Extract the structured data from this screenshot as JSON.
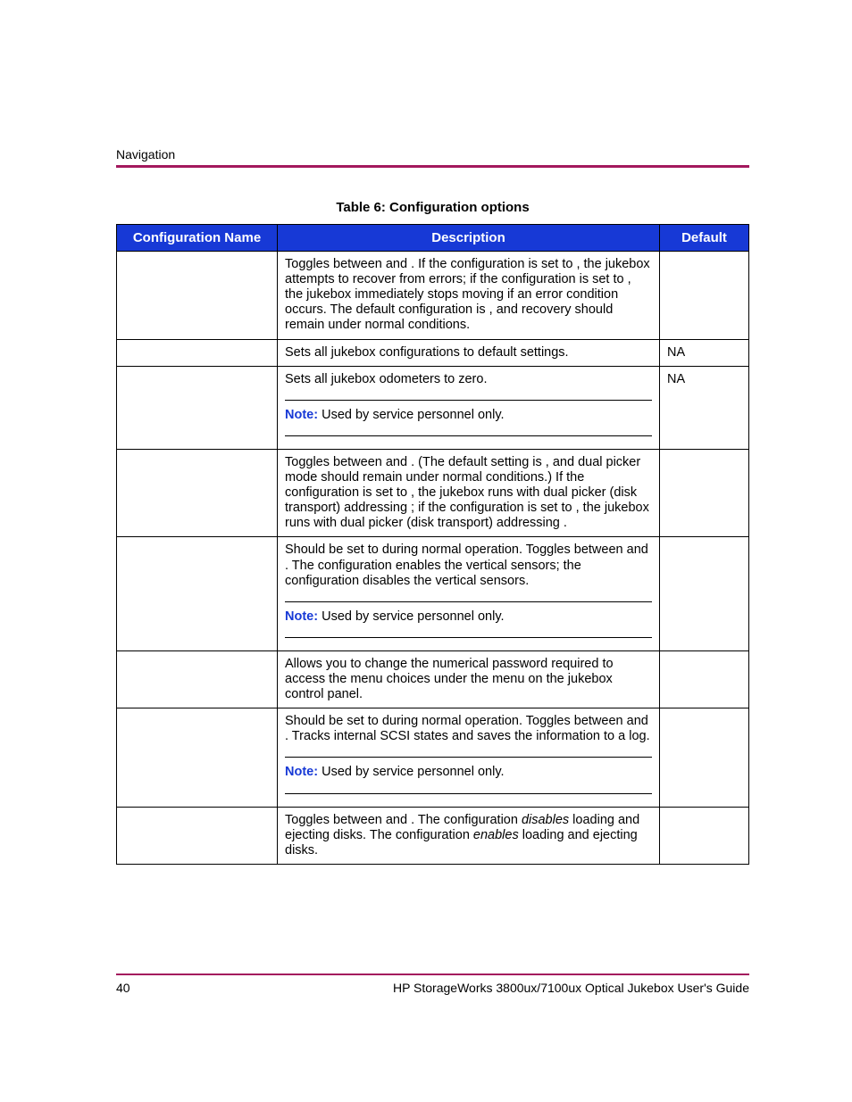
{
  "navigation_label": "Navigation",
  "table_title": "Table 6:  Configuration options",
  "headers": {
    "name": "Configuration Name",
    "desc": "Description",
    "def": "Default"
  },
  "rows": {
    "r1": {
      "desc_text": "Toggles between       and       . If the configuration is set to     , the jukebox attempts to recover from errors; if the configuration is set to      , the jukebox immediately stops moving if an error condition occurs. The default configuration is                         , and recovery should remain        under normal conditions.",
      "def": ""
    },
    "r2": {
      "desc_text": "Sets all jukebox configurations to default settings.",
      "def": "NA"
    },
    "r3": {
      "desc_text": "Sets all jukebox odometers to zero.",
      "note": "Used by service personnel only.",
      "def": "NA"
    },
    "r4": {
      "desc_text": "Toggles between       and       .  (The default setting is                   , and dual picker mode should remain        under normal conditions.)  If the configuration is set to     , the jukebox runs with dual picker (disk transport) addressing      ; if the configuration is set to      , the jukebox runs with dual picker (disk transport) addressing       .",
      "def": ""
    },
    "r5": {
      "desc_text": "Should be set to       during normal operation. Toggles between       and       . The       configuration enables the vertical sensors; the        configuration disables the vertical sensors.",
      "note": "Used by service personnel only.",
      "def": ""
    },
    "r6": {
      "desc_text": "Allows you to change the numerical password required to access the menu choices under the              menu on the jukebox control panel.",
      "def": ""
    },
    "r7": {
      "desc_text": "Should be set to        during normal operation. Toggles between       and       . Tracks internal SCSI states and saves the information to a log.",
      "note": "Used by service personnel only.",
      "def": ""
    },
    "r8": {
      "desc_pre": "Toggles between       and       . The       configuration ",
      "disables_word": "disables",
      "desc_mid": " loading and ejecting disks. The        configuration ",
      "enables_word": "enables",
      "desc_post": " loading and ejecting disks.",
      "def": ""
    }
  },
  "note_label": "Note:  ",
  "footer": {
    "page_number": "40",
    "doc_title": "HP StorageWorks 3800ux/7100ux Optical Jukebox User's Guide"
  }
}
